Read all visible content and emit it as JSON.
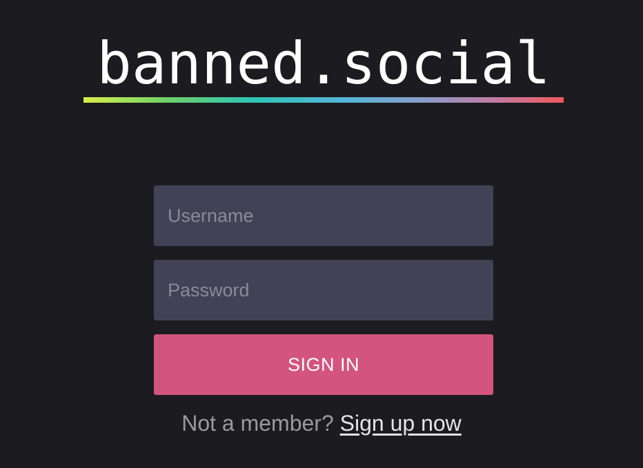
{
  "brand": {
    "title": "banned.social"
  },
  "login": {
    "username_placeholder": "Username",
    "password_placeholder": "Password",
    "submit_label": "SIGN IN"
  },
  "signup": {
    "prompt": "Not a member?",
    "link_label": "Sign up now"
  },
  "colors": {
    "background": "#1c1b1f",
    "input_background": "#424155",
    "accent": "#d3547f",
    "underline_gradient": [
      "#d7f04a",
      "#2ec4b6",
      "#56b4d9",
      "#ef5a5e"
    ]
  }
}
